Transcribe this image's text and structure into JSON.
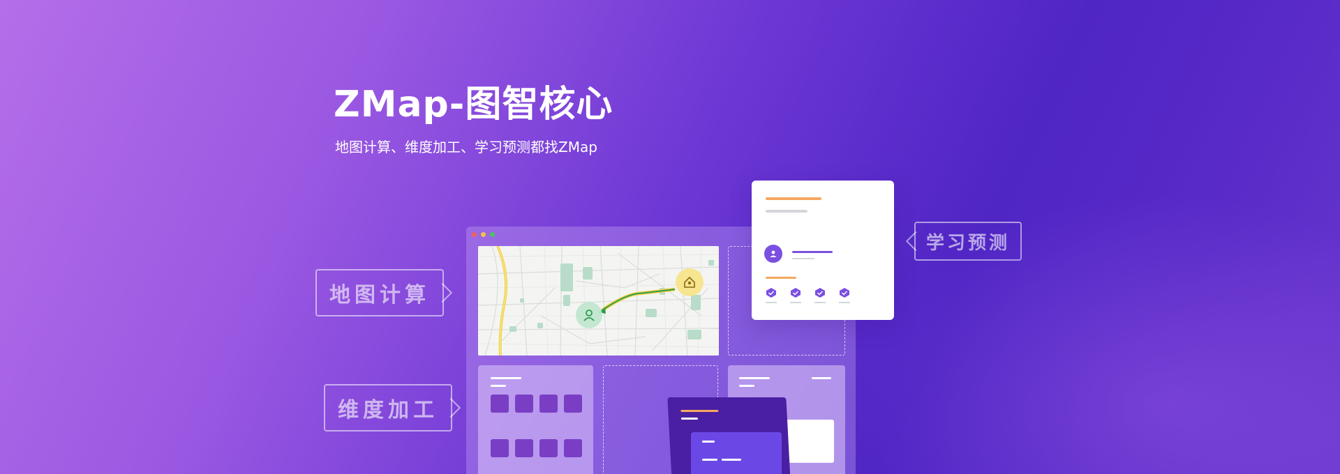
{
  "hero": {
    "title": "ZMap-图智核心",
    "subtitle": "地图计算、维度加工、学习预测都找ZMap"
  },
  "callouts": {
    "map_compute": "地图计算",
    "dimension_process": "维度加工",
    "learn_predict": "学习预测"
  },
  "colors": {
    "background_start": "#b46ee9",
    "background_end": "#4f25c4",
    "accent_orange": "#f7a861",
    "accent_purple": "#7b4fe0",
    "route_green": "#2e9b4d",
    "route_yellow": "#f2d24a"
  },
  "icons": {
    "user_marker": "user-icon",
    "home_marker": "home-icon",
    "check_badge": "shield-check-icon",
    "avatar": "avatar-icon"
  }
}
